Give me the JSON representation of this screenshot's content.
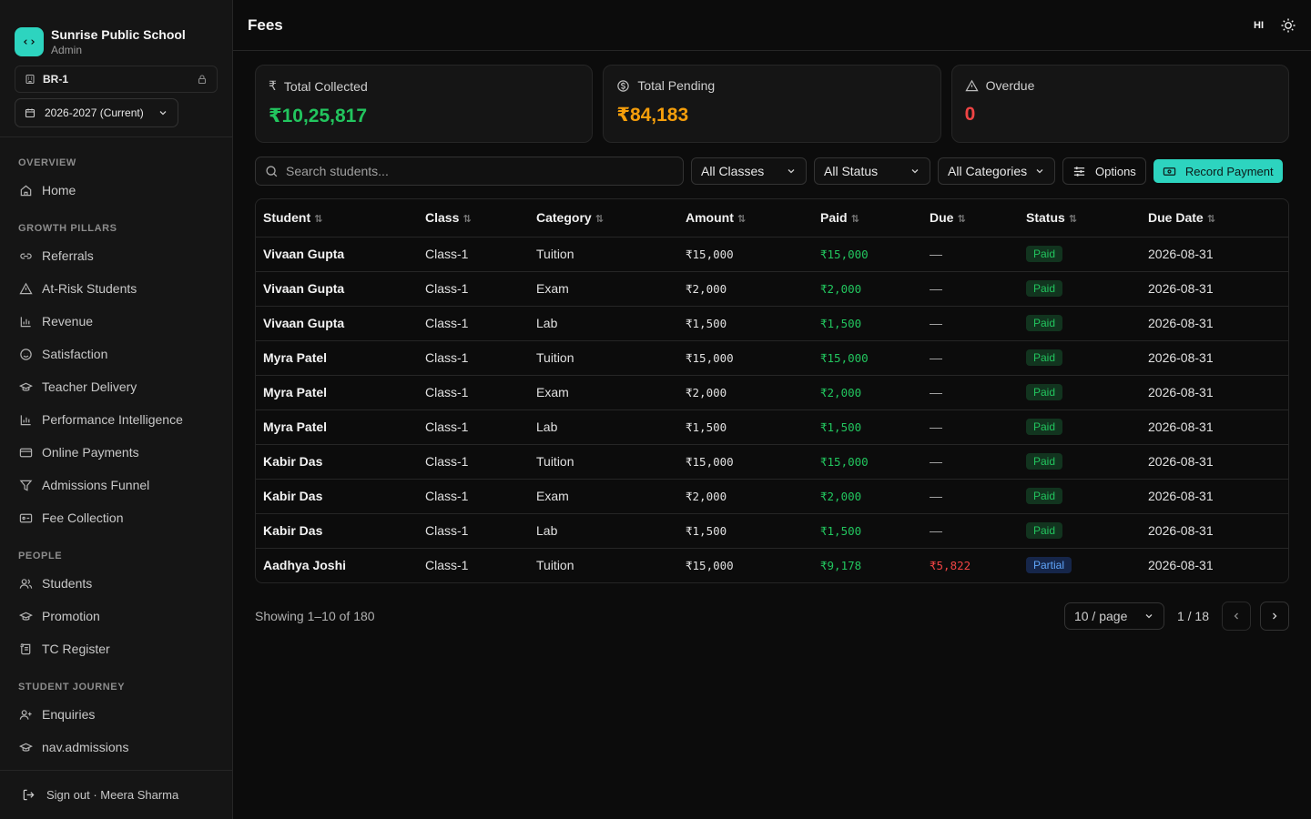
{
  "sidebar": {
    "brand_name": "Sunrise Public School",
    "brand_role": "Admin",
    "branch": "BR-1",
    "year": "2026-2027 (Current)",
    "sections": [
      {
        "title": "OVERVIEW",
        "items": [
          {
            "label": "Home",
            "icon": "home-icon"
          }
        ]
      },
      {
        "title": "GROWTH PILLARS",
        "items": [
          {
            "label": "Referrals",
            "icon": "link-icon"
          },
          {
            "label": "At-Risk Students",
            "icon": "warning-icon"
          },
          {
            "label": "Revenue",
            "icon": "bar-chart-icon"
          },
          {
            "label": "Satisfaction",
            "icon": "smile-icon"
          },
          {
            "label": "Teacher Delivery",
            "icon": "graduation-cap-icon"
          },
          {
            "label": "Performance Intelligence",
            "icon": "bar-chart-icon"
          },
          {
            "label": "Online Payments",
            "icon": "credit-card-icon"
          },
          {
            "label": "Admissions Funnel",
            "icon": "funnel-icon"
          },
          {
            "label": "Fee Collection",
            "icon": "wallet-icon"
          }
        ]
      },
      {
        "title": "PEOPLE",
        "items": [
          {
            "label": "Students",
            "icon": "users-icon"
          },
          {
            "label": "Promotion",
            "icon": "graduation-cap-icon"
          },
          {
            "label": "TC Register",
            "icon": "scroll-icon"
          }
        ]
      },
      {
        "title": "STUDENT JOURNEY",
        "items": [
          {
            "label": "Enquiries",
            "icon": "user-plus-icon"
          },
          {
            "label": "nav.admissions",
            "icon": "graduation-cap-icon"
          }
        ]
      }
    ],
    "signout": "Sign out · Meera Sharma"
  },
  "header": {
    "title": "Fees",
    "lang": "HI"
  },
  "stats": {
    "collected_label": "Total Collected",
    "collected_value": "₹10,25,817",
    "pending_label": "Total Pending",
    "pending_value": "₹84,183",
    "overdue_label": "Overdue",
    "overdue_value": "0"
  },
  "toolbar": {
    "search_placeholder": "Search students...",
    "classes": "All Classes",
    "status": "All Status",
    "categories": "All Categories",
    "options": "Options",
    "record_payment": "Record Payment"
  },
  "table": {
    "columns": [
      "Student",
      "Class",
      "Category",
      "Amount",
      "Paid",
      "Due",
      "Status",
      "Due Date"
    ],
    "rows": [
      {
        "student": "Vivaan Gupta",
        "class": "Class-1",
        "category": "Tuition",
        "amount": "₹15,000",
        "paid": "₹15,000",
        "due": "—",
        "status": "Paid",
        "due_date": "2026-08-31"
      },
      {
        "student": "Vivaan Gupta",
        "class": "Class-1",
        "category": "Exam",
        "amount": "₹2,000",
        "paid": "₹2,000",
        "due": "—",
        "status": "Paid",
        "due_date": "2026-08-31"
      },
      {
        "student": "Vivaan Gupta",
        "class": "Class-1",
        "category": "Lab",
        "amount": "₹1,500",
        "paid": "₹1,500",
        "due": "—",
        "status": "Paid",
        "due_date": "2026-08-31"
      },
      {
        "student": "Myra Patel",
        "class": "Class-1",
        "category": "Tuition",
        "amount": "₹15,000",
        "paid": "₹15,000",
        "due": "—",
        "status": "Paid",
        "due_date": "2026-08-31"
      },
      {
        "student": "Myra Patel",
        "class": "Class-1",
        "category": "Exam",
        "amount": "₹2,000",
        "paid": "₹2,000",
        "due": "—",
        "status": "Paid",
        "due_date": "2026-08-31"
      },
      {
        "student": "Myra Patel",
        "class": "Class-1",
        "category": "Lab",
        "amount": "₹1,500",
        "paid": "₹1,500",
        "due": "—",
        "status": "Paid",
        "due_date": "2026-08-31"
      },
      {
        "student": "Kabir Das",
        "class": "Class-1",
        "category": "Tuition",
        "amount": "₹15,000",
        "paid": "₹15,000",
        "due": "—",
        "status": "Paid",
        "due_date": "2026-08-31"
      },
      {
        "student": "Kabir Das",
        "class": "Class-1",
        "category": "Exam",
        "amount": "₹2,000",
        "paid": "₹2,000",
        "due": "—",
        "status": "Paid",
        "due_date": "2026-08-31"
      },
      {
        "student": "Kabir Das",
        "class": "Class-1",
        "category": "Lab",
        "amount": "₹1,500",
        "paid": "₹1,500",
        "due": "—",
        "status": "Paid",
        "due_date": "2026-08-31"
      },
      {
        "student": "Aadhya Joshi",
        "class": "Class-1",
        "category": "Tuition",
        "amount": "₹15,000",
        "paid": "₹9,178",
        "due": "₹5,822",
        "status": "Partial",
        "due_date": "2026-08-31"
      }
    ]
  },
  "pagination": {
    "showing": "Showing 1–10 of 180",
    "per_page": "10 / page",
    "page": "1 / 18"
  },
  "colors": {
    "accent": "#2dd4bf",
    "green": "#22c55e",
    "amber": "#f59e0b",
    "red": "#ef4444",
    "blue": "#60a5fa"
  }
}
